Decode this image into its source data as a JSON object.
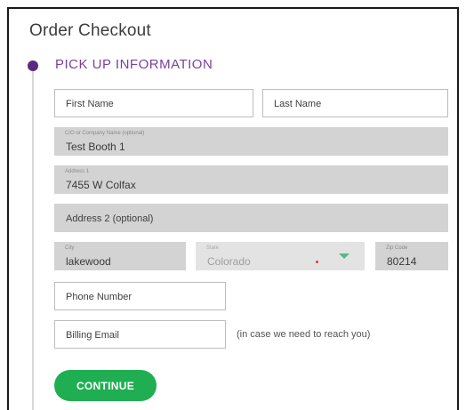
{
  "page": {
    "title": "Order Checkout"
  },
  "section": {
    "title": "PICK UP INFORMATION"
  },
  "fields": {
    "first_name": {
      "placeholder": "First Name"
    },
    "last_name": {
      "placeholder": "Last Name"
    },
    "company": {
      "label": "C/O or Company Name (optional)",
      "value": "Test Booth 1"
    },
    "address1": {
      "label": "Address 1",
      "value": "7455 W Colfax"
    },
    "address2": {
      "placeholder": "Address 2 (optional)"
    },
    "city": {
      "label": "City",
      "value": "lakewood"
    },
    "state": {
      "label": "State",
      "value": "Colorado"
    },
    "zip": {
      "label": "Zip Code",
      "value": "80214"
    },
    "phone": {
      "placeholder": "Phone Number"
    },
    "email": {
      "placeholder": "Billing Email",
      "hint": "(in case we need to reach you)"
    }
  },
  "actions": {
    "continue_label": "CONTINUE"
  },
  "colors": {
    "accent_purple": "#7b3f9e",
    "timeline_dot": "#5b2a7e",
    "continue_green": "#1fae52",
    "dropdown_chevron": "#52b98a",
    "required_marker": "#e53935"
  },
  "icons": {
    "state_dropdown": "chevron-down-icon",
    "step_marker": "step-dot-icon"
  }
}
